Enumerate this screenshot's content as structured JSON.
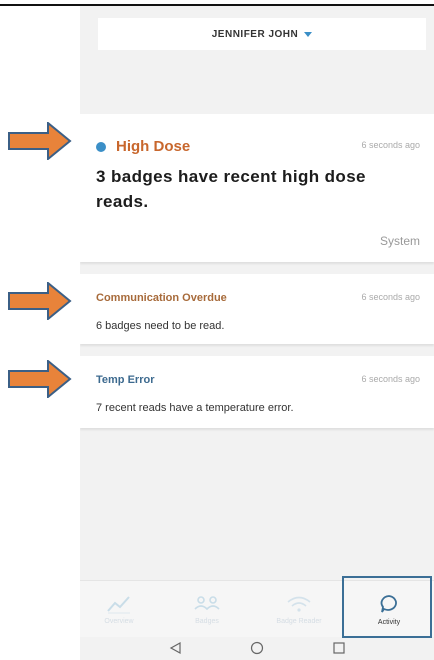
{
  "header": {
    "user_name": "JENNIFER JOHN"
  },
  "alerts": [
    {
      "title": "High Dose",
      "time": "6 seconds ago",
      "message": "3 badges have recent high dose reads.",
      "source": "System"
    },
    {
      "title": "Communication Overdue",
      "time": "6 seconds ago",
      "message": "6 badges need to be read."
    },
    {
      "title": "Temp Error",
      "time": "6 seconds ago",
      "message": "7 recent reads have a temperature error."
    }
  ],
  "tabs": [
    {
      "label": "Overview",
      "icon": "chart-line-icon"
    },
    {
      "label": "Badges",
      "icon": "people-group-icon"
    },
    {
      "label": "Badge Reader",
      "icon": "wifi-icon"
    },
    {
      "label": "Activity",
      "icon": "chat-bubble-icon",
      "active": true
    }
  ],
  "colors": {
    "accent": "#3b8fc7",
    "high_dose": "#c8672d",
    "comm": "#a76a3a",
    "temp": "#3d6a8f",
    "arrow": "#e8833a"
  }
}
